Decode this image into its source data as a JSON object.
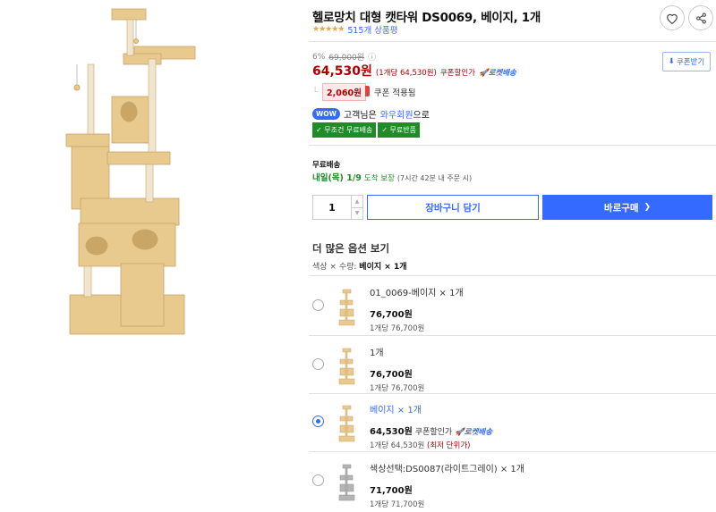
{
  "product": {
    "title": "헬로망치 대형 캣타워 DS0069, 베이지, 1개",
    "stars": "★★★★★",
    "review_count": "515개 상품평"
  },
  "price": {
    "discount_rate": "6%",
    "original_price": "69,000원",
    "info_icon": "ⓘ",
    "sale_price": "64,530원",
    "unit_price": "(1개당 64,530원)",
    "coupon_note": "쿠폰할인가",
    "rocket_label": "로켓배송",
    "coupon_amount": "2,060원",
    "coupon_applied": "쿠폰 적용됨",
    "coupon_button": "쿠폰받기"
  },
  "wow": {
    "badge": "WOW",
    "prefix": "고객님은",
    "member": "와우회원",
    "suffix": "으로"
  },
  "shipping_badges": [
    "✓ 무조건 무료배송",
    "✓ 무료반품"
  ],
  "delivery": {
    "label": "무료배송",
    "date": "내일(목) 1/9",
    "guarantee": "도착 보장",
    "note": "(7시간 42분 내 주문 시)"
  },
  "purchase": {
    "quantity": "1",
    "cart_label": "장바구니 담기",
    "buy_label": "바로구매",
    "buy_arrow": "❯"
  },
  "options": {
    "title": "더 많은 옵션 보기",
    "summary_prefix": "색상 × 수량:",
    "summary_value": "베이지 × 1개",
    "items": [
      {
        "name": "01_0069-베이지 × 1개",
        "price": "76,700원",
        "coupon": "",
        "rocket": "",
        "unit": "1개당 76,700원",
        "lowest": "",
        "selected": false
      },
      {
        "name": "1개",
        "price": "76,700원",
        "coupon": "",
        "rocket": "",
        "unit": "1개당 76,700원",
        "lowest": "",
        "selected": false
      },
      {
        "name": "베이지 × 1개",
        "price": "64,530원",
        "coupon": "쿠폰할인가",
        "rocket": "로켓배송",
        "unit": "1개당 64,530원",
        "lowest": "(최저 단위가)",
        "selected": true
      },
      {
        "name": "색상선택:DS0087(라이트그레이) × 1개",
        "price": "71,700원",
        "coupon": "",
        "rocket": "",
        "unit": "1개당 71,700원",
        "lowest": "",
        "selected": false
      }
    ]
  },
  "colors": {
    "accent": "#346aff",
    "price_red": "#ae0000",
    "ship_green": "#1f8c28",
    "tower_beige": "#e8c98e",
    "tower_gray": "#b5b5b5"
  }
}
